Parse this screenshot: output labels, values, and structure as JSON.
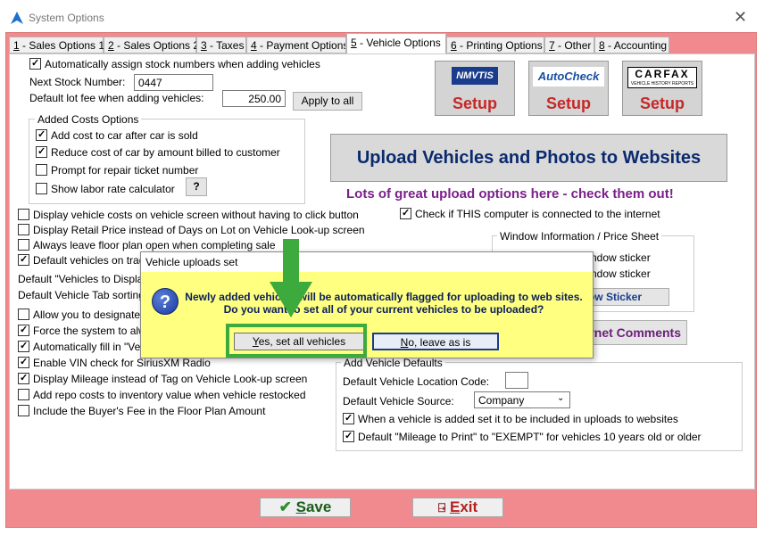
{
  "window": {
    "title": "System Options",
    "close_glyph": "✕"
  },
  "tabs": [
    {
      "num": "1",
      "label": " - Sales Options 1"
    },
    {
      "num": "2",
      "label": " - Sales Options 2"
    },
    {
      "num": "3",
      "label": " - Taxes"
    },
    {
      "num": "4",
      "label": " - Payment Options"
    },
    {
      "num": "5",
      "label": " - Vehicle Options"
    },
    {
      "num": "6",
      "label": " - Printing Options"
    },
    {
      "num": "7",
      "label": " - Other"
    },
    {
      "num": "8",
      "label": " - Accounting"
    }
  ],
  "vehicle": {
    "auto_stock_label": "Automatically assign stock numbers when adding vehicles",
    "next_stock_label": "Next Stock Number:",
    "next_stock_value": "0447",
    "lot_fee_label": "Default lot fee when adding vehicles:",
    "lot_fee_value": "250.00",
    "apply_all": "Apply to all",
    "added_costs_legend": "Added Costs Options",
    "added_costs": [
      {
        "label": "Add cost to car after car is sold",
        "checked": true
      },
      {
        "label": "Reduce cost of car by amount billed to customer",
        "checked": true
      },
      {
        "label": "Prompt for repair ticket number",
        "checked": false
      },
      {
        "label": "Show labor rate calculator",
        "checked": false
      }
    ],
    "help_btn": "?",
    "checks_a": [
      {
        "label": "Display vehicle costs on vehicle screen without having to click button",
        "checked": false
      },
      {
        "label": "Display Retail Price instead of Days on Lot on Vehicle Look-up screen",
        "checked": false
      },
      {
        "label": "Always leave floor plan open when completing sale",
        "checked": false
      },
      {
        "label": "Default vehicles on trad",
        "checked": true
      }
    ],
    "default_display_label": "Default \"Vehicles to Displa",
    "default_tab_label": "Default Vehicle Tab sorting",
    "checks_b": [
      {
        "label": "Allow you to designate",
        "checked": false
      },
      {
        "label": "Force the system to alw",
        "checked": true
      },
      {
        "label": "Automatically fill in \"Ve",
        "checked": true
      },
      {
        "label": "Enable VIN check for SiriusXM Radio",
        "checked": true
      },
      {
        "label": "Display Mileage instead of Tag on Vehicle Look-up screen",
        "checked": true
      },
      {
        "label": "Add repo costs to inventory value when vehicle restocked",
        "checked": false
      },
      {
        "label": "Include the Buyer's Fee in the Floor Plan Amount",
        "checked": false
      }
    ]
  },
  "setup": [
    {
      "logo": "NMVTIS",
      "label": "Setup"
    },
    {
      "logo": "AutoCheck",
      "label": "Setup"
    },
    {
      "logo": "CARFAX",
      "sub": "VEHICLE HISTORY REPORTS",
      "label": "Setup"
    }
  ],
  "upload_btn": "Upload Vehicles and Photos to Websites",
  "promo": "Lots of great upload options here - check them out!",
  "internet_check": "Check if THIS computer is connected to the internet",
  "window_info": {
    "legend": "Window Information / Price Sheet",
    "line1": "ndow sticker",
    "line2": "ndow sticker",
    "btn": "ow Sticker"
  },
  "internet_comments": "ernet Comments",
  "add_defaults": {
    "legend": "Add Vehicle Defaults",
    "location_label": "Default Vehicle Location Code:",
    "location_value": "",
    "source_label": "Default Vehicle Source:",
    "source_value": "Company",
    "check1": "When a vehicle is added set it to be included in uploads to websites",
    "check2": "Default \"Mileage to Print\" to \"EXEMPT\" for vehicles 10 years old or older"
  },
  "footer": {
    "save_s": "S",
    "save_rest": "ave",
    "exit_e": "E",
    "exit_rest": "xit"
  },
  "dialog": {
    "title": "Vehicle uploads set",
    "line1": "Newly added vehicles will be automatically flagged for uploading to web sites.",
    "line2": "Do you want to set all of your current vehicles to be uploaded?",
    "yes_y": "Y",
    "yes_rest": "es, set all vehicles",
    "no_n": "N",
    "no_rest": "o, leave as is"
  },
  "colors": {
    "frame": "#f08a8e",
    "dialog": "#ffff80",
    "highlight": "#3daa3d",
    "setup_text": "#c62828",
    "promo": "#7b1f8a"
  }
}
